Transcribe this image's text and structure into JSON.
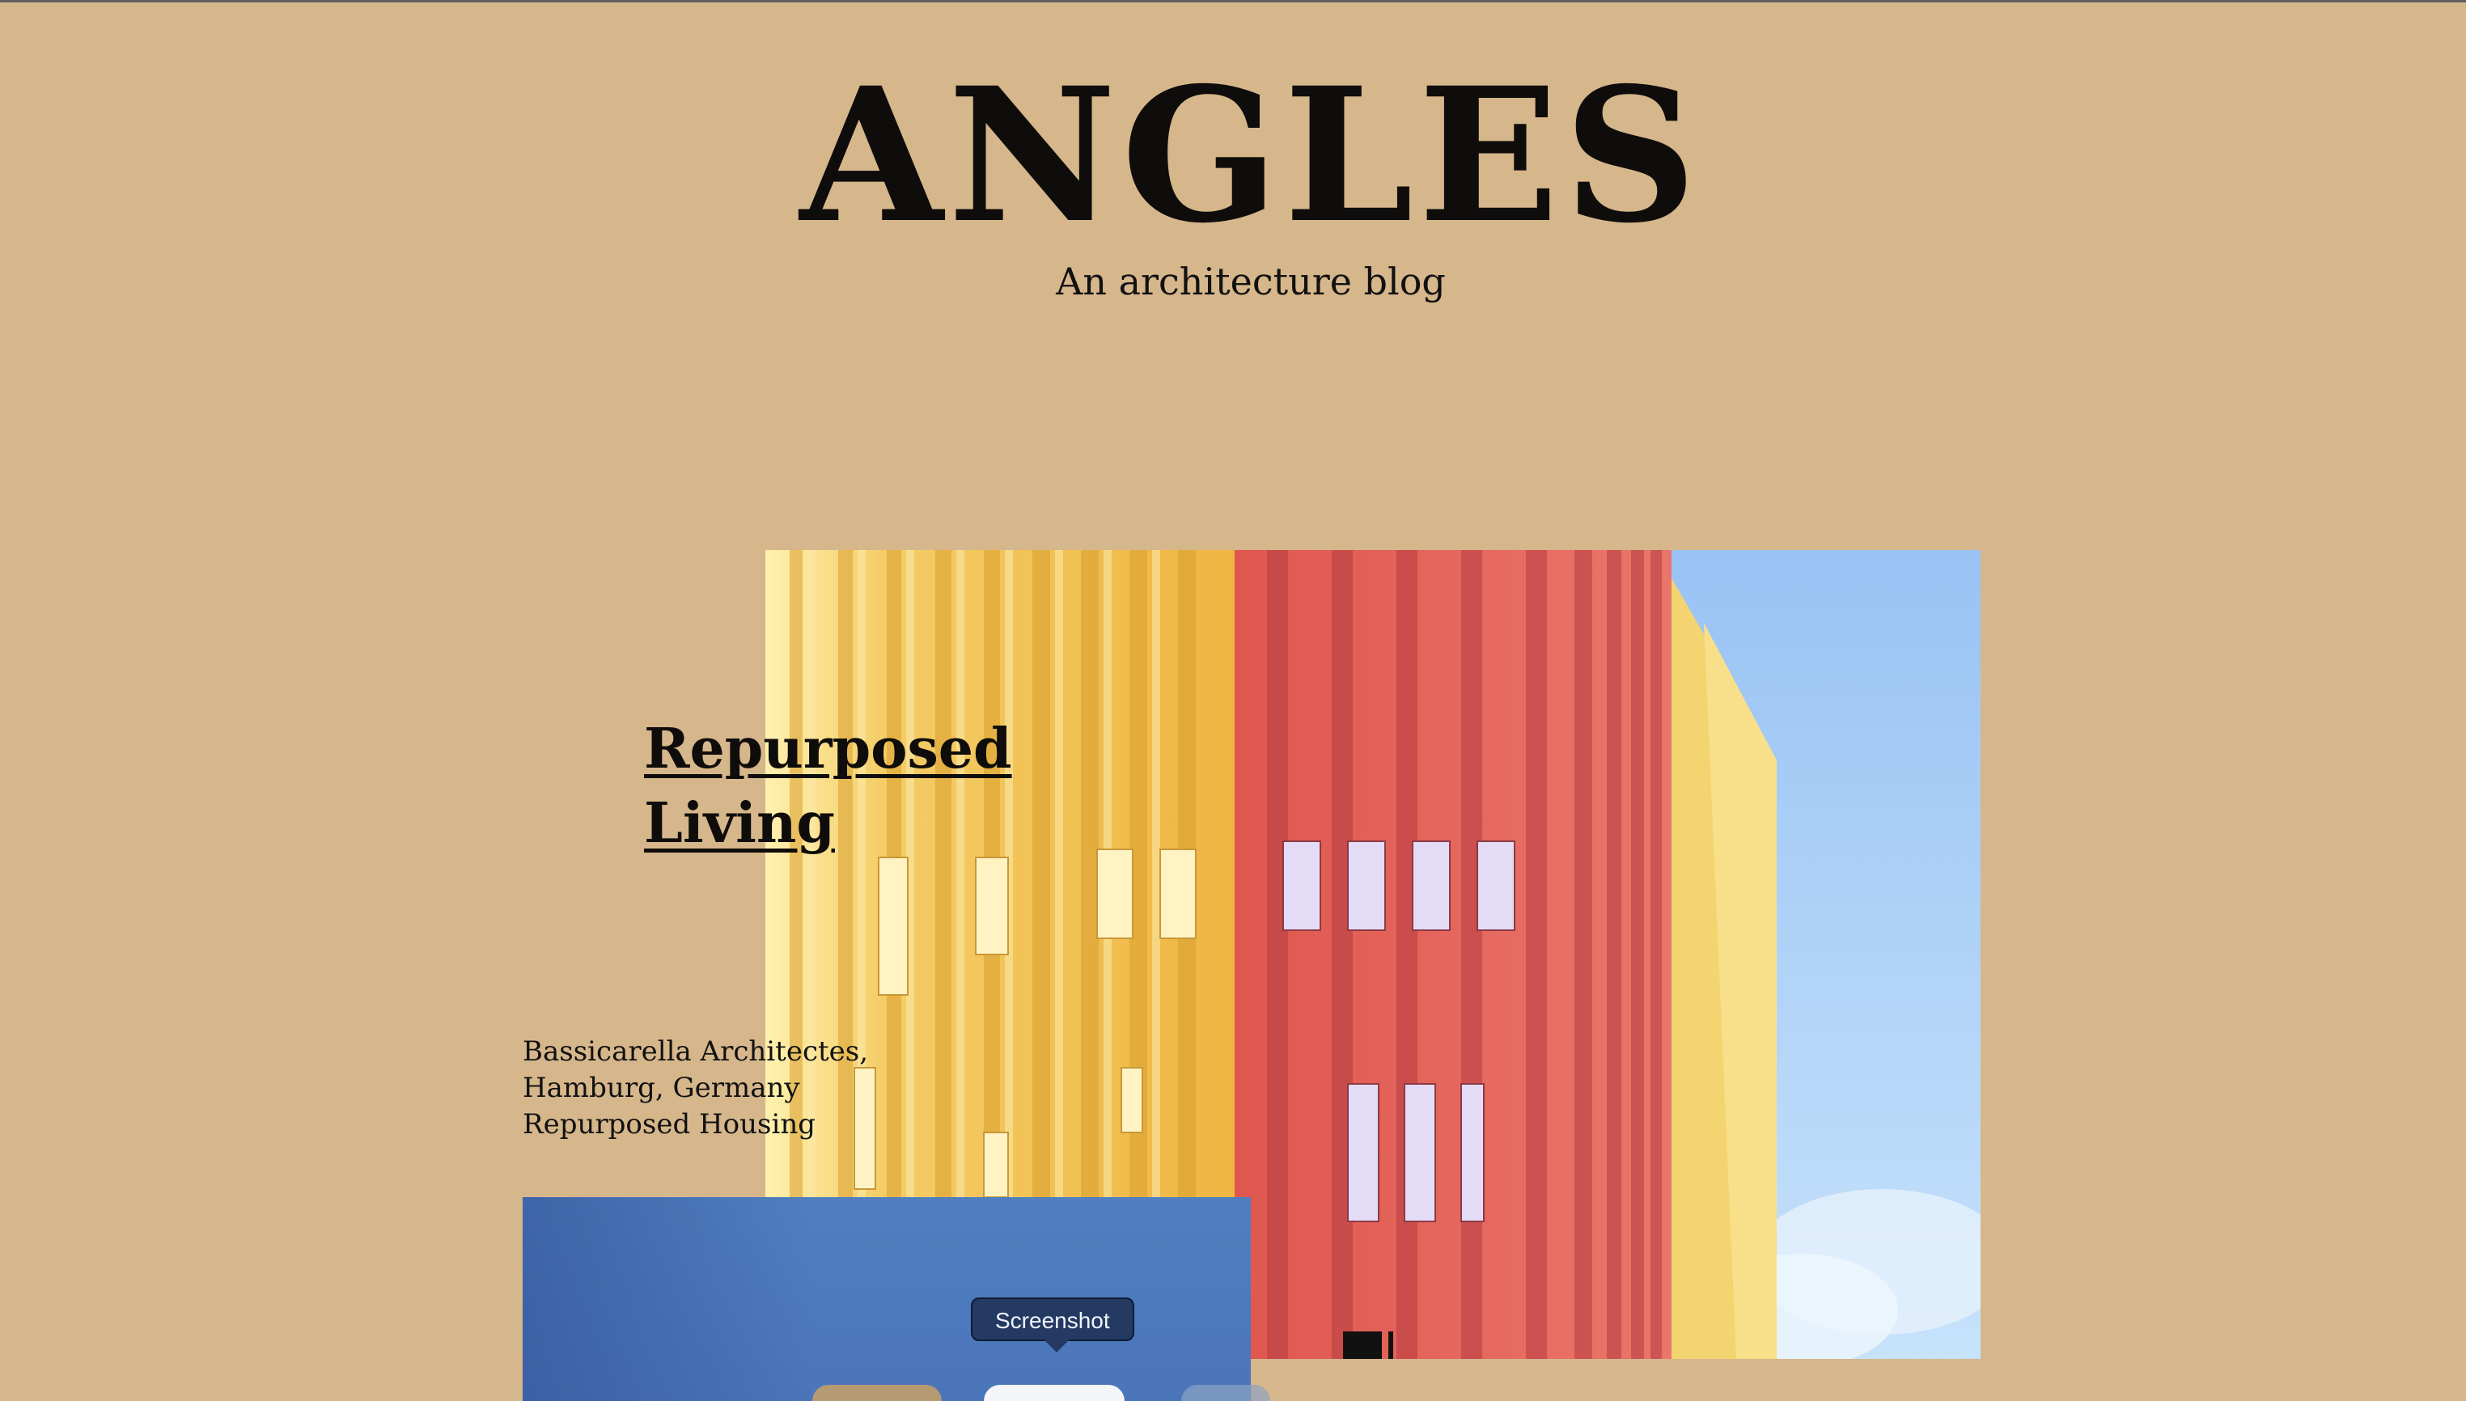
{
  "site": {
    "title": "ANGLES",
    "tagline": "An architecture blog"
  },
  "post": {
    "title": "Repurposed Living",
    "meta_lines": [
      "Bassicarella Architectes,",
      "Hamburg, Germany",
      "Repurposed Housing"
    ],
    "image_alt": "colorful-building-facade-photo"
  },
  "overlay": {
    "tooltip_text": "Screenshot"
  },
  "colors": {
    "page_background": "#d6b68b",
    "text": "#0f0d0b",
    "overlay_panel": "#4f7fc0",
    "tooltip_background": "#243a63",
    "facade_yellow": "#f2c45b",
    "facade_red": "#e46a5d",
    "sky": "#a8cdf6"
  }
}
